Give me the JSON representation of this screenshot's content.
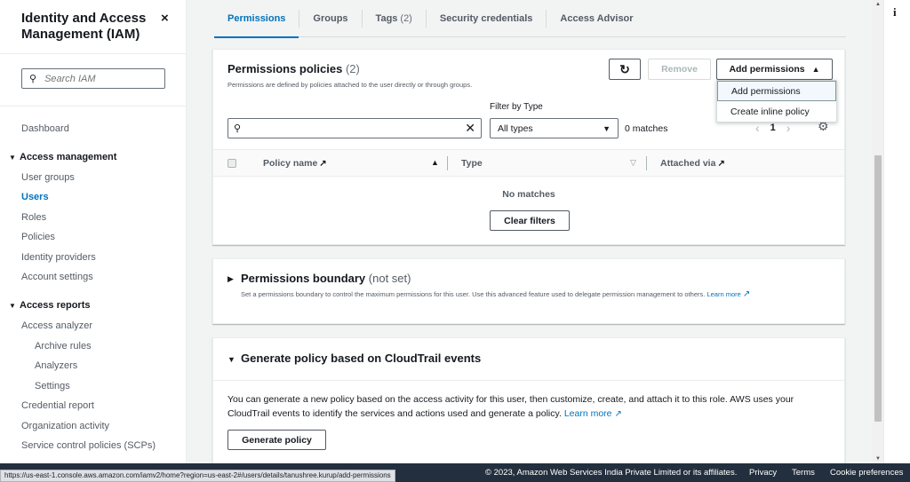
{
  "sidebar": {
    "title": "Identity and Access Management (IAM)",
    "close_icon": "×",
    "search_placeholder": "Search IAM",
    "dashboard": "Dashboard",
    "access_management": {
      "label": "Access management",
      "items": [
        "User groups",
        "Users",
        "Roles",
        "Policies",
        "Identity providers",
        "Account settings"
      ],
      "active": "Users"
    },
    "access_reports": {
      "label": "Access reports",
      "analyzer": "Access analyzer",
      "analyzer_sub": [
        "Archive rules",
        "Analyzers",
        "Settings"
      ],
      "items": [
        "Credential report",
        "Organization activity",
        "Service control policies (SCPs)"
      ]
    }
  },
  "tabs": [
    {
      "label": "Permissions",
      "count": ""
    },
    {
      "label": "Groups",
      "count": ""
    },
    {
      "label": "Tags",
      "count": "(2)"
    },
    {
      "label": "Security credentials",
      "count": ""
    },
    {
      "label": "Access Advisor",
      "count": ""
    }
  ],
  "permissions_policies": {
    "title": "Permissions policies",
    "count": "(2)",
    "description": "Permissions are defined by policies attached to the user directly or through groups.",
    "remove_label": "Remove",
    "add_label": "Add permissions",
    "dropdown": [
      "Add permissions",
      "Create inline policy"
    ],
    "filter_label": "Filter by Type",
    "filter_value": "All types",
    "matches": "0 matches",
    "page": "1",
    "columns": [
      "Policy name",
      "Type",
      "Attached via"
    ],
    "empty": "No matches",
    "clear_filters": "Clear filters"
  },
  "permissions_boundary": {
    "title": "Permissions boundary",
    "status": "(not set)",
    "description": "Set a permissions boundary to control the maximum permissions for this user. Use this advanced feature used to delegate permission management to others.",
    "learn_more": "Learn more"
  },
  "generate_policy": {
    "title": "Generate policy based on CloudTrail events",
    "description": "You can generate a new policy based on the access activity for this user, then customize, create, and attach it to this role. AWS uses your CloudTrail events to identify the services and actions used and generate a policy.",
    "learn_more": "Learn more",
    "button": "Generate policy"
  },
  "footer": {
    "copyright": "© 2023, Amazon Web Services India Private Limited or its affiliates.",
    "links": [
      "Privacy",
      "Terms",
      "Cookie preferences"
    ],
    "status_url": "https://us-east-1.console.aws.amazon.com/iamv2/home?region=us-east-2#/users/details/tanushree.kurup/add-permissions"
  },
  "info_icon": "i"
}
